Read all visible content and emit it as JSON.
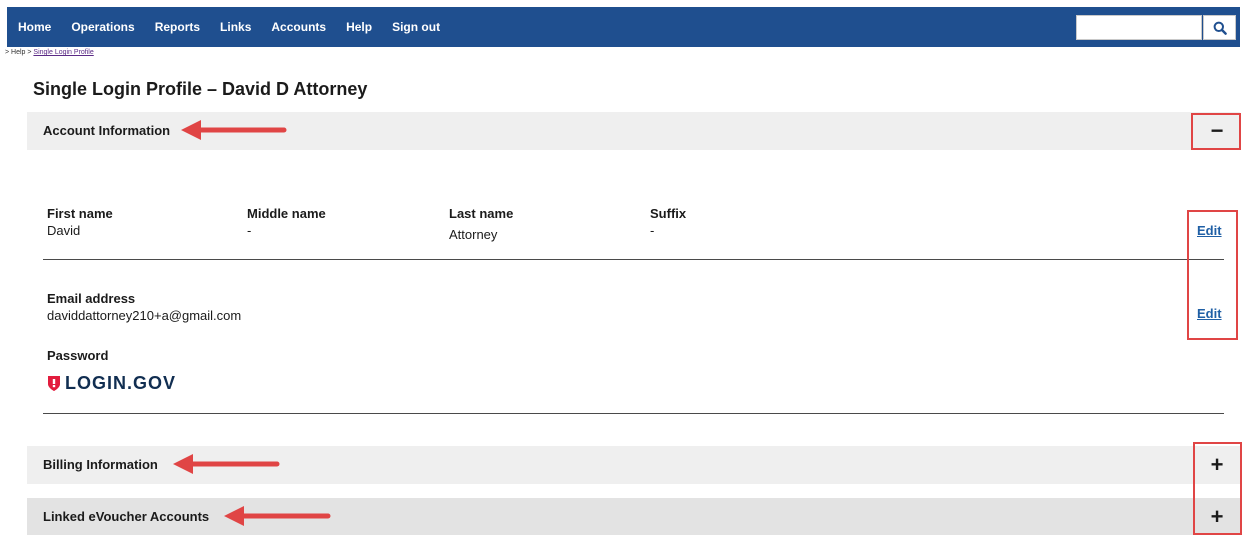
{
  "nav": {
    "items": [
      "Home",
      "Operations",
      "Reports",
      "Links",
      "Accounts",
      "Help",
      "Sign out"
    ]
  },
  "search": {
    "placeholder": "",
    "icon": "search-icon"
  },
  "breadcrumb": {
    "prefix": "> Help > ",
    "current": "Single Login Profile"
  },
  "page": {
    "title": "Single Login Profile – David D Attorney"
  },
  "sections": {
    "account": {
      "title": "Account Information",
      "toggle": "−"
    },
    "billing": {
      "title": "Billing Information",
      "toggle": "+"
    },
    "linked": {
      "title": "Linked eVoucher Accounts",
      "toggle": "+"
    }
  },
  "account": {
    "first_name_label": "First name",
    "first_name": "David",
    "middle_name_label": "Middle name",
    "middle_name": "-",
    "last_name_label": "Last name",
    "last_name": "Attorney",
    "suffix_label": "Suffix",
    "suffix": "-",
    "email_label": "Email address",
    "email": "daviddattorney210+a@gmail.com",
    "password_label": "Password",
    "logo_text": "LOGIN.GOV",
    "edit_label": "Edit"
  },
  "colors": {
    "nav_bg": "#1f4f8f",
    "annotation": "#e04545",
    "link": "#1f5fa5",
    "logo_red": "#e21c3d",
    "logo_navy": "#112e51"
  }
}
